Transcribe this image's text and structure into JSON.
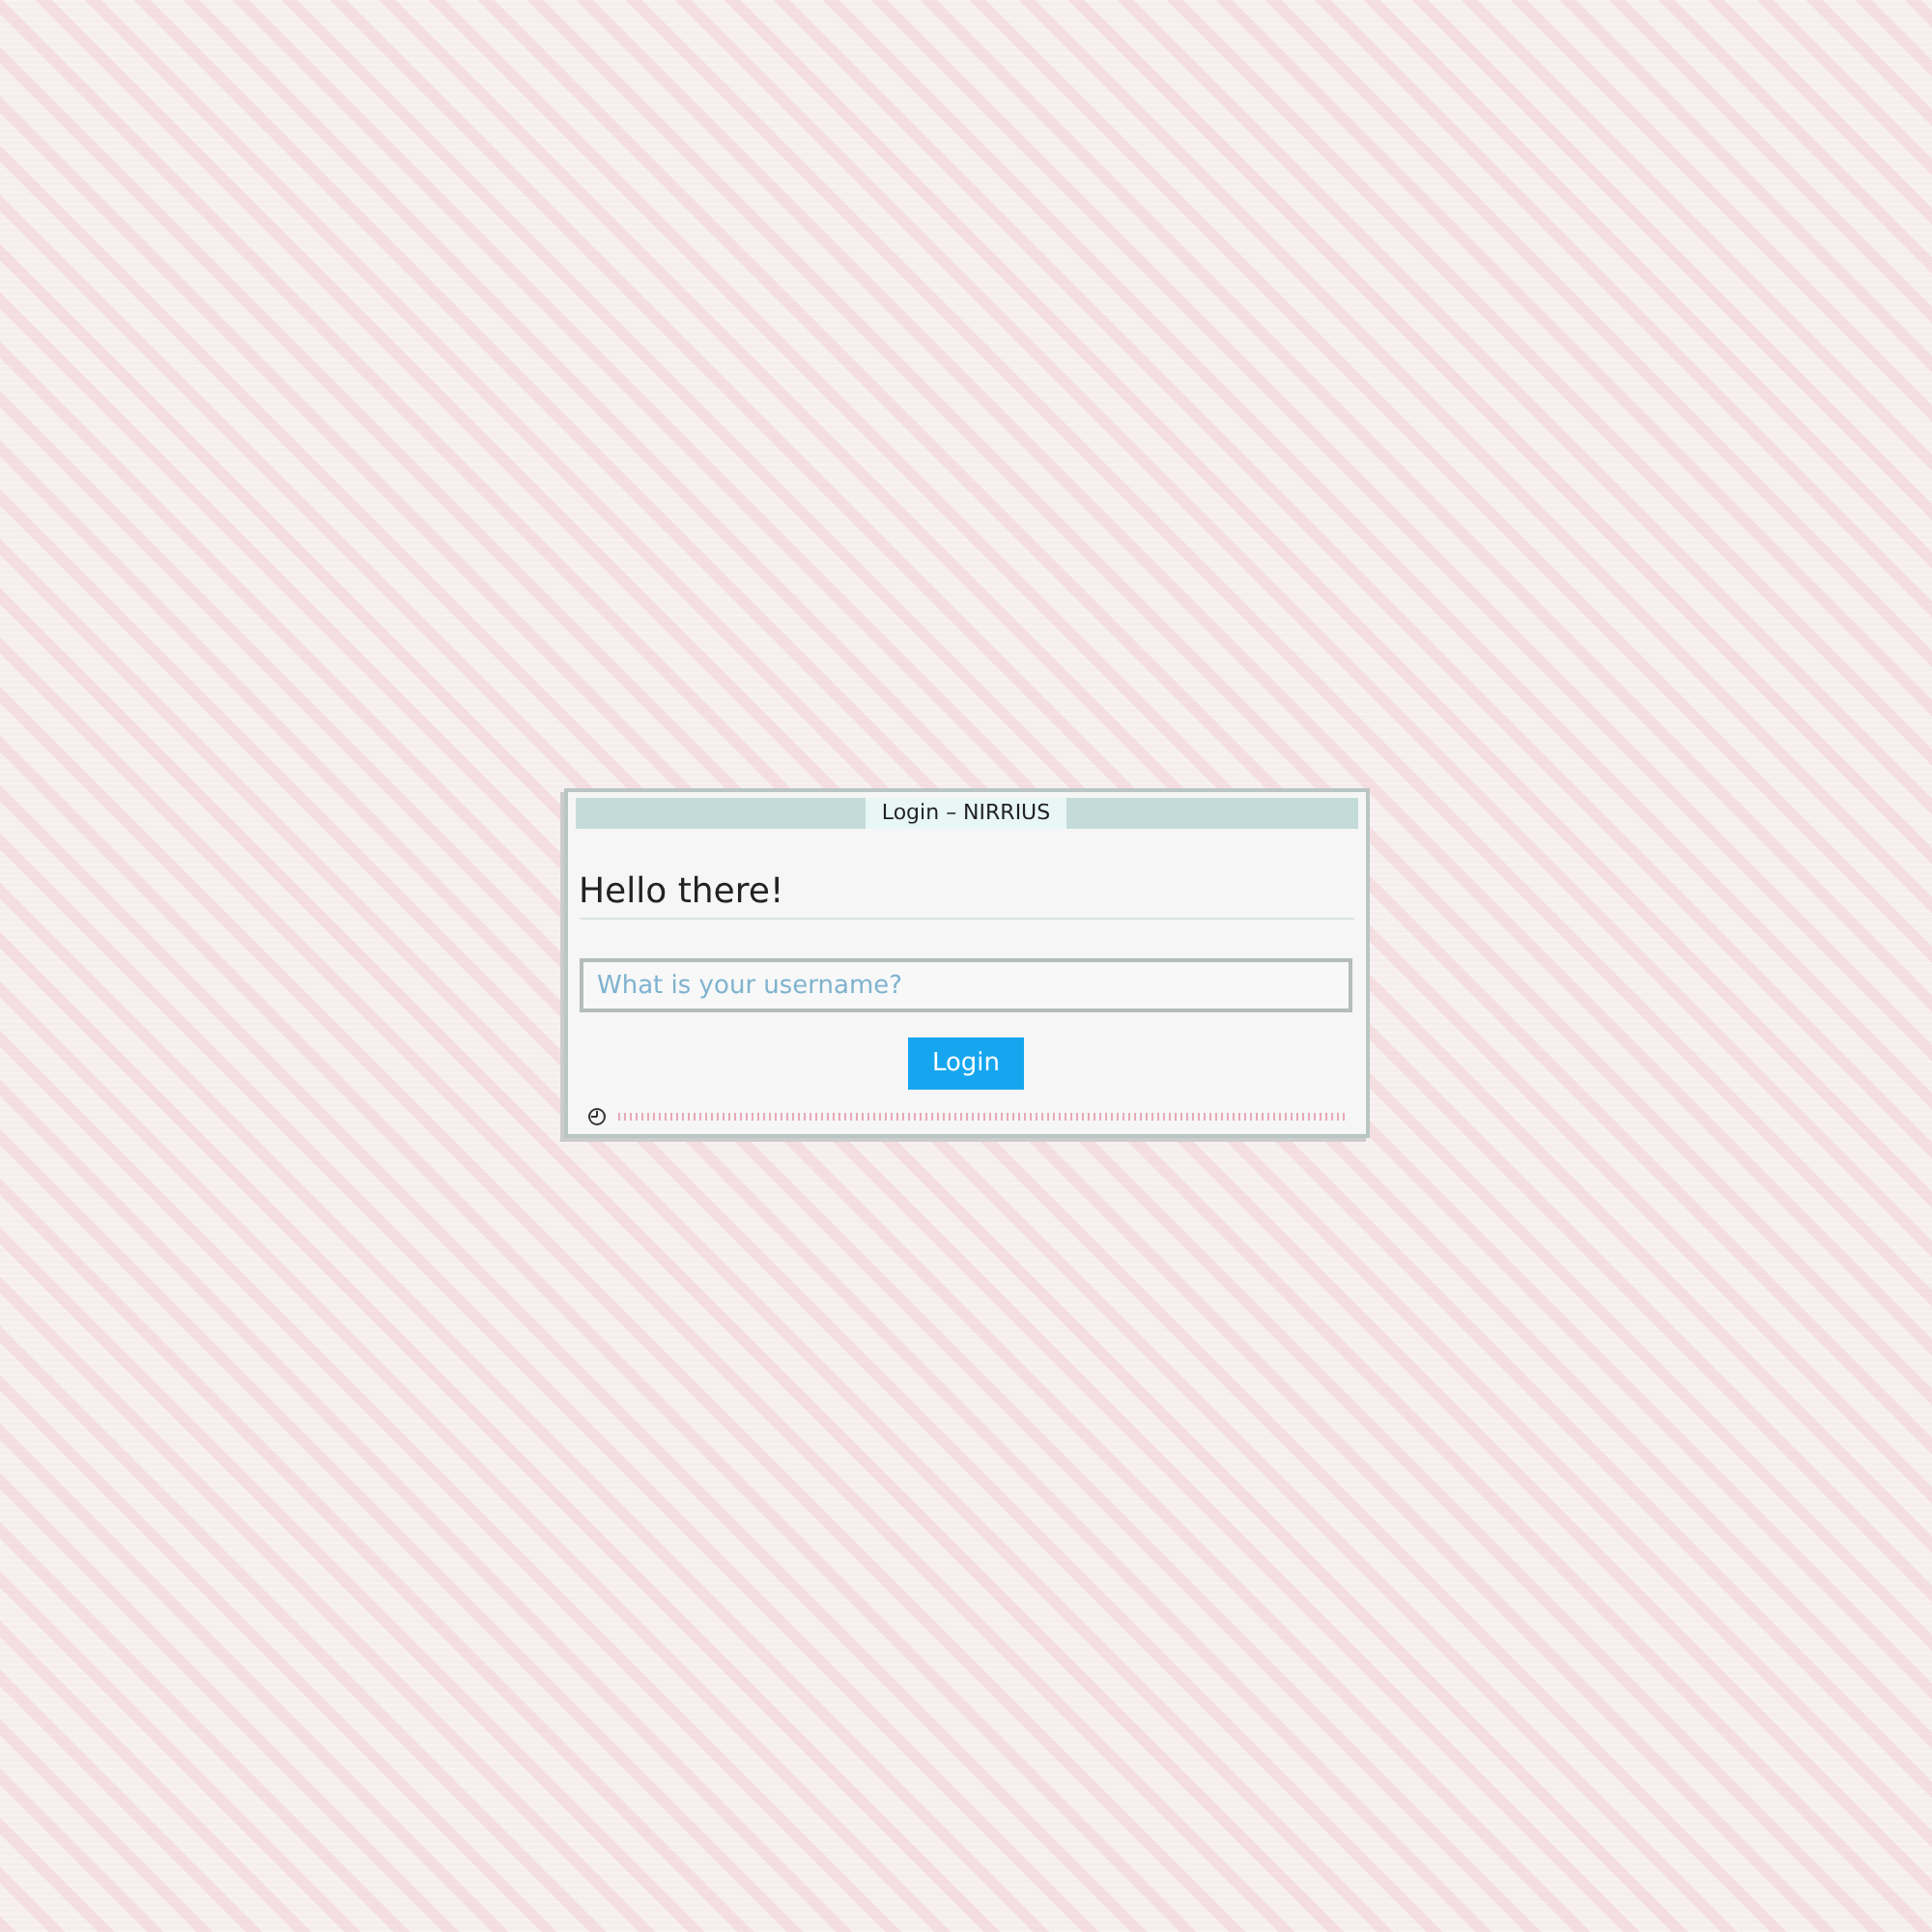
{
  "window": {
    "title": "Login – NIRRIUS"
  },
  "heading": "Hello there!",
  "username": {
    "placeholder": "What is your username?"
  },
  "buttons": [
    "Login"
  ]
}
